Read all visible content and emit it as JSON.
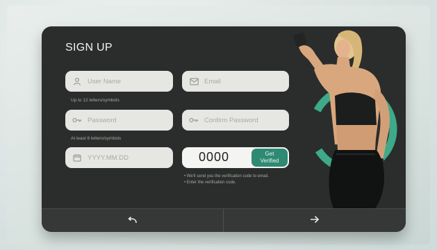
{
  "form": {
    "title": "SIGN UP",
    "username": {
      "placeholder": "User Name",
      "hint": "Up to 12 letters/symbols"
    },
    "email": {
      "placeholder": "Email"
    },
    "password": {
      "placeholder": "Password",
      "hint": "At least 6 letters/symbols"
    },
    "confirm_password": {
      "placeholder": "Confirm Password"
    },
    "birthdate": {
      "placeholder": "YYYY.MM.DD"
    },
    "verification": {
      "code": "0000",
      "button_line1": "Get",
      "button_line2": "Verified",
      "note_line1": "• We'll send you the verification code to email.",
      "note_line2": "• Enter the verification code."
    }
  },
  "nav": {
    "back_icon": "undo-arrow-icon",
    "next_icon": "right-arrow-icon"
  },
  "colors": {
    "card": "#2b2d2c",
    "field": "#e6e6e3",
    "accent": "#2e8a72",
    "ring": "#3fb894"
  }
}
